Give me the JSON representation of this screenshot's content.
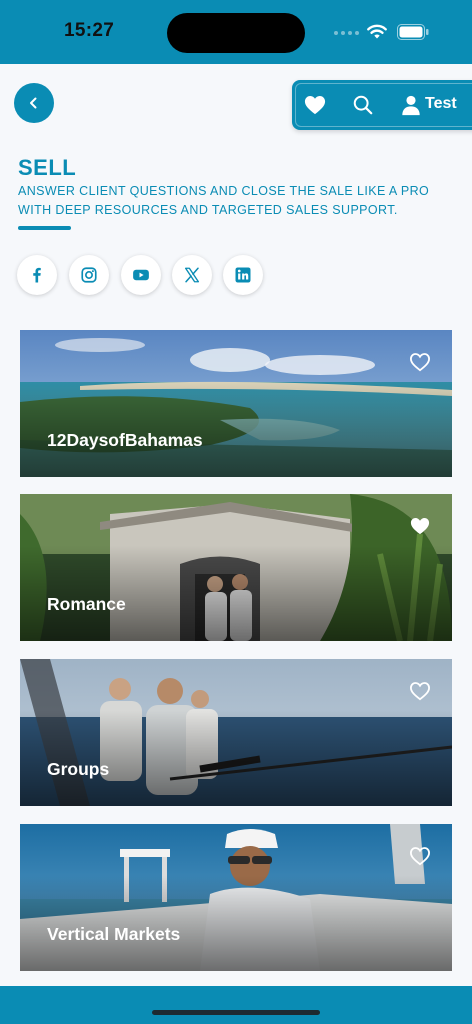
{
  "status_bar": {
    "time": "15:27"
  },
  "header": {
    "back_icon": "chevron-left-icon",
    "actions": {
      "favorites_icon": "heart-icon",
      "search_icon": "search-icon",
      "user_icon": "user-icon",
      "user_label": "Test"
    }
  },
  "page": {
    "title": "SELL",
    "subtitle": "ANSWER CLIENT QUESTIONS AND CLOSE THE SALE LIKE A PRO WITH DEEP RESOURCES AND TARGETED SALES SUPPORT."
  },
  "social_links": [
    {
      "icon": "facebook-icon"
    },
    {
      "icon": "instagram-icon"
    },
    {
      "icon": "youtube-icon"
    },
    {
      "icon": "x-icon"
    },
    {
      "icon": "linkedin-icon"
    }
  ],
  "cards": [
    {
      "label": "12DaysofBahamas",
      "favorited": false
    },
    {
      "label": "Romance",
      "favorited": true
    },
    {
      "label": "Groups",
      "favorited": false
    },
    {
      "label": "Vertical Markets",
      "favorited": false
    }
  ],
  "colors": {
    "accent": "#0a8cb4",
    "background": "#f6f8fb"
  }
}
